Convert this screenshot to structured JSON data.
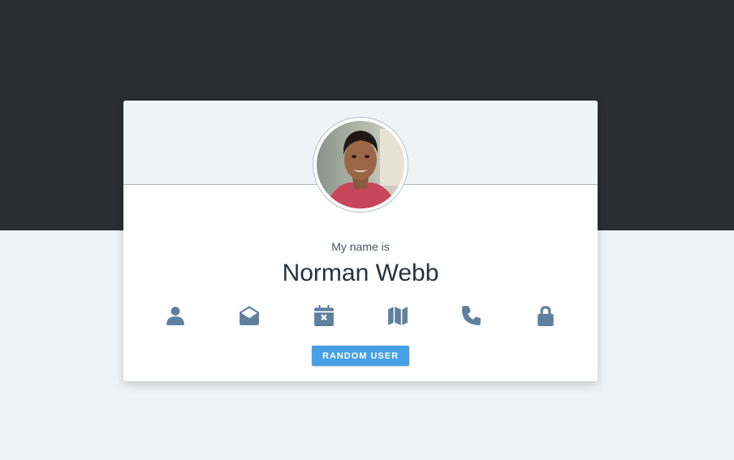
{
  "card": {
    "intro_text": "My name is",
    "name": "Norman Webb",
    "random_button_label": "RANDOM USER"
  },
  "icons": [
    {
      "name": "user-icon"
    },
    {
      "name": "envelope-open-icon"
    },
    {
      "name": "calendar-times-icon"
    },
    {
      "name": "map-icon"
    },
    {
      "name": "phone-icon"
    },
    {
      "name": "lock-icon"
    }
  ],
  "colors": {
    "background": "#eff3f6",
    "top_band": "#2c2d31",
    "icon": "#5f7f9e",
    "button": "#45a0e6",
    "name_text": "#27323e"
  }
}
